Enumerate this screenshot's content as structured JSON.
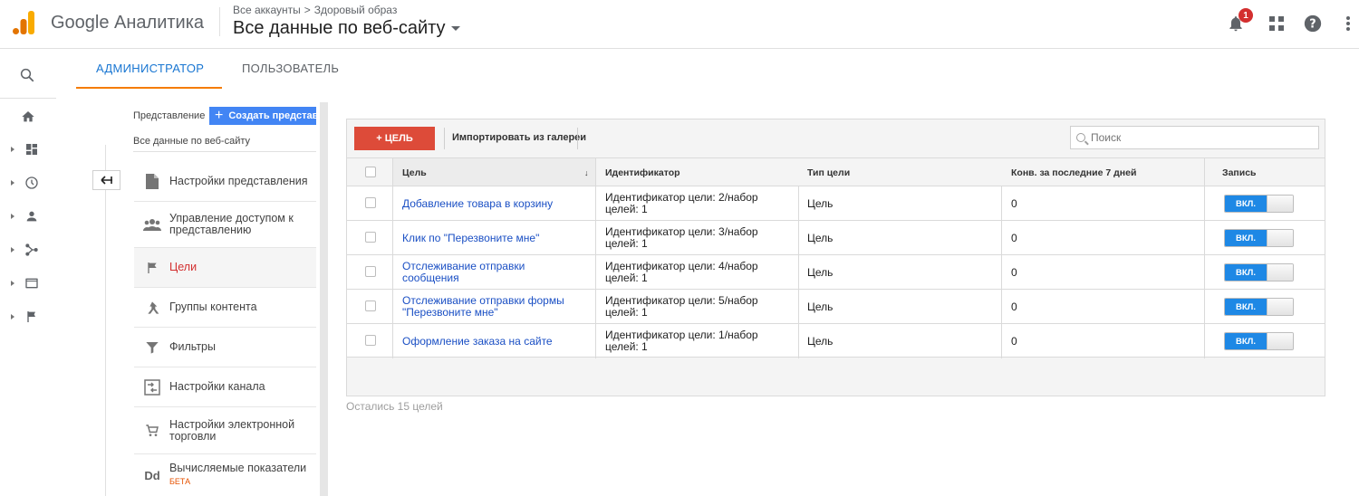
{
  "app": {
    "brand": "Google Аналитика"
  },
  "breadcrumb": {
    "account": "Все аккаунты",
    "separator": ">",
    "property": "Здоровый образ"
  },
  "view_selector": {
    "label": "Все данные по веб-сайту"
  },
  "header_icons": {
    "notifications_count": "1",
    "notifications_icon": "bell-icon",
    "apps_icon": "apps-grid-icon",
    "help_icon": "help-icon",
    "more_icon": "more-vert-icon"
  },
  "left_nav": {
    "items": [
      {
        "icon": "search-icon"
      },
      {
        "icon": "home-icon"
      },
      {
        "icon": "dashboard-icon"
      },
      {
        "icon": "clock-icon"
      },
      {
        "icon": "person-icon"
      },
      {
        "icon": "acquisition-icon"
      },
      {
        "icon": "behavior-icon"
      },
      {
        "icon": "flag-icon"
      }
    ]
  },
  "tabs": [
    {
      "label": "АДМИНИСТРАТОР",
      "active": true
    },
    {
      "label": "ПОЛЬЗОВАТЕЛЬ",
      "active": false
    }
  ],
  "view_panel": {
    "label": "Представление",
    "create_button": "Создать представл",
    "view_name": "Все данные по веб-сайту",
    "menu": [
      {
        "label": "Настройки представления",
        "icon": "document-icon"
      },
      {
        "label": "Управление доступом к представлению",
        "icon": "people-icon"
      },
      {
        "label": "Цели",
        "icon": "flag-icon",
        "active": true
      },
      {
        "label": "Группы контента",
        "icon": "content-group-icon"
      },
      {
        "label": "Фильтры",
        "icon": "filter-icon"
      },
      {
        "label": "Настройки канала",
        "icon": "channel-icon"
      },
      {
        "label": "Настройки электронной торговли",
        "icon": "cart-icon"
      },
      {
        "label": "Вычисляемые показатели",
        "icon": "dd-icon",
        "badge": "БЕТА"
      }
    ]
  },
  "goals_toolbar": {
    "add_goal": "+ ЦЕЛЬ",
    "import_gallery": "Импортировать из галереи",
    "search_placeholder": "Поиск"
  },
  "goals_table": {
    "headers": {
      "goal": "Цель",
      "id": "Идентификатор",
      "type": "Тип цели",
      "conv": "Конв. за последние 7 дней",
      "record": "Запись"
    },
    "rows": [
      {
        "name": "Добавление товара в корзину",
        "id_line1": "Идентификатор цели: 2/набор",
        "id_line2": "целей: 1",
        "type": "Цель",
        "conv": "0",
        "record": "ВКЛ."
      },
      {
        "name": "Клик по \"Перезвоните мне\"",
        "id_line1": "Идентификатор цели: 3/набор",
        "id_line2": "целей: 1",
        "type": "Цель",
        "conv": "0",
        "record": "ВКЛ."
      },
      {
        "name_line1": "Отслеживание отправки",
        "name_line2": "сообщения",
        "id_line1": "Идентификатор цели: 4/набор",
        "id_line2": "целей: 1",
        "type": "Цель",
        "conv": "0",
        "record": "ВКЛ."
      },
      {
        "name_line1": "Отслеживание отправки формы",
        "name_line2": "\"Перезвоните мне\"",
        "id_line1": "Идентификатор цели: 5/набор",
        "id_line2": "целей: 1",
        "type": "Цель",
        "conv": "0",
        "record": "ВКЛ."
      },
      {
        "name": "Оформление заказа на сайте",
        "id_line1": "Идентификатор цели: 1/набор",
        "id_line2": "целей: 1",
        "type": "Цель",
        "conv": "0",
        "record": "ВКЛ."
      }
    ]
  },
  "remaining_goals": "Остались 15 целей",
  "colors": {
    "accent_blue": "#1976d2",
    "tab_underline": "#f57c00",
    "add_goal_red": "#dd4b39",
    "toggle_blue": "#1e88e5",
    "active_menu_red": "#d32f2f"
  }
}
